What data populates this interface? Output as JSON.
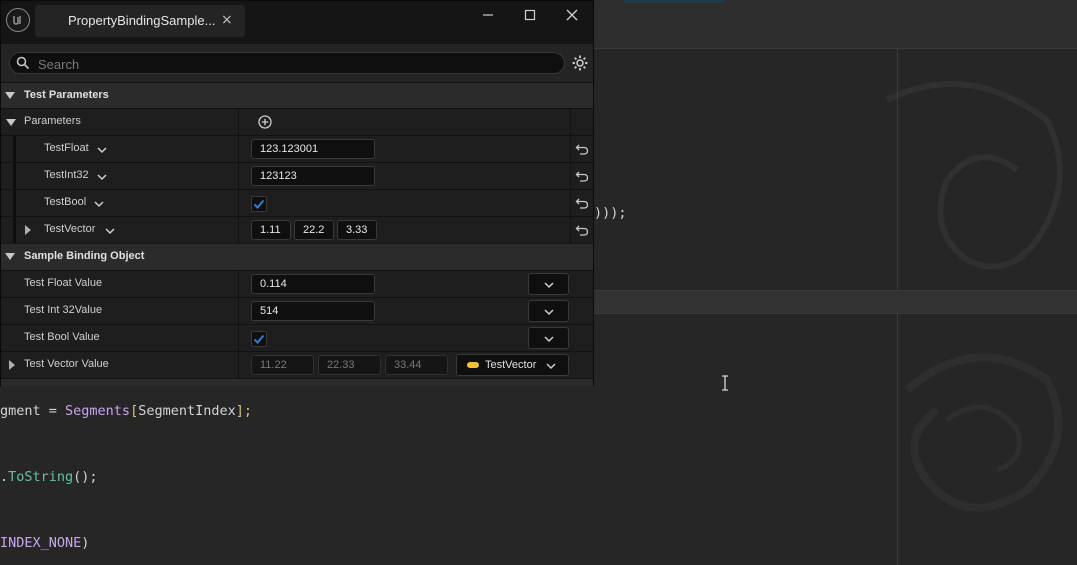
{
  "editor": {
    "code_lines": [
      {
        "parts": [
          {
            "t": ")));",
            "c": "c-op"
          }
        ]
      },
      {
        "parts": [
          {
            "t": "gment = ",
            "c": "c-ident"
          },
          {
            "t": "Segments",
            "c": "c-purple"
          },
          {
            "t": "[",
            "c": "c-yellow"
          },
          {
            "t": "SegmentIndex",
            "c": "c-ident"
          },
          {
            "t": "];",
            "c": "c-yellow"
          }
        ]
      },
      {
        "parts": [
          {
            "t": ".",
            "c": "c-op"
          },
          {
            "t": "ToString",
            "c": "c-green"
          },
          {
            "t": "();",
            "c": "c-op"
          }
        ]
      },
      {
        "parts": [
          {
            "t": "INDEX_NONE",
            "c": "c-const"
          },
          {
            "t": ")",
            "c": "c-op"
          }
        ]
      }
    ]
  },
  "window": {
    "tab_title": "PropertyBindingSample...",
    "tab_close": "×",
    "minimize": "—",
    "maximize": "☐",
    "close": "✕",
    "search_placeholder": "Search",
    "sections": {
      "test_parameters": "Test Parameters",
      "sample_binding_object": "Sample Binding Object"
    },
    "parameters_label": "Parameters",
    "params": [
      {
        "name": "TestFloat",
        "value": "123.123001"
      },
      {
        "name": "TestInt32",
        "value": "123123"
      },
      {
        "name": "TestBool",
        "checked": true
      },
      {
        "name": "TestVector",
        "x": "1.11",
        "y": "22.2",
        "z": "3.33"
      }
    ],
    "bindings": [
      {
        "name": "Test Float Value",
        "value": "0.114"
      },
      {
        "name": "Test Int 32Value",
        "value": "514"
      },
      {
        "name": "Test Bool Value",
        "checked": true
      },
      {
        "name": "Test Vector Value",
        "x": "11.22",
        "y": "22.33",
        "z": "33.44",
        "binding": "TestVector"
      }
    ]
  },
  "colors": {
    "checkbox": "#2f7fd6",
    "vector_pill": "#f2c230"
  }
}
